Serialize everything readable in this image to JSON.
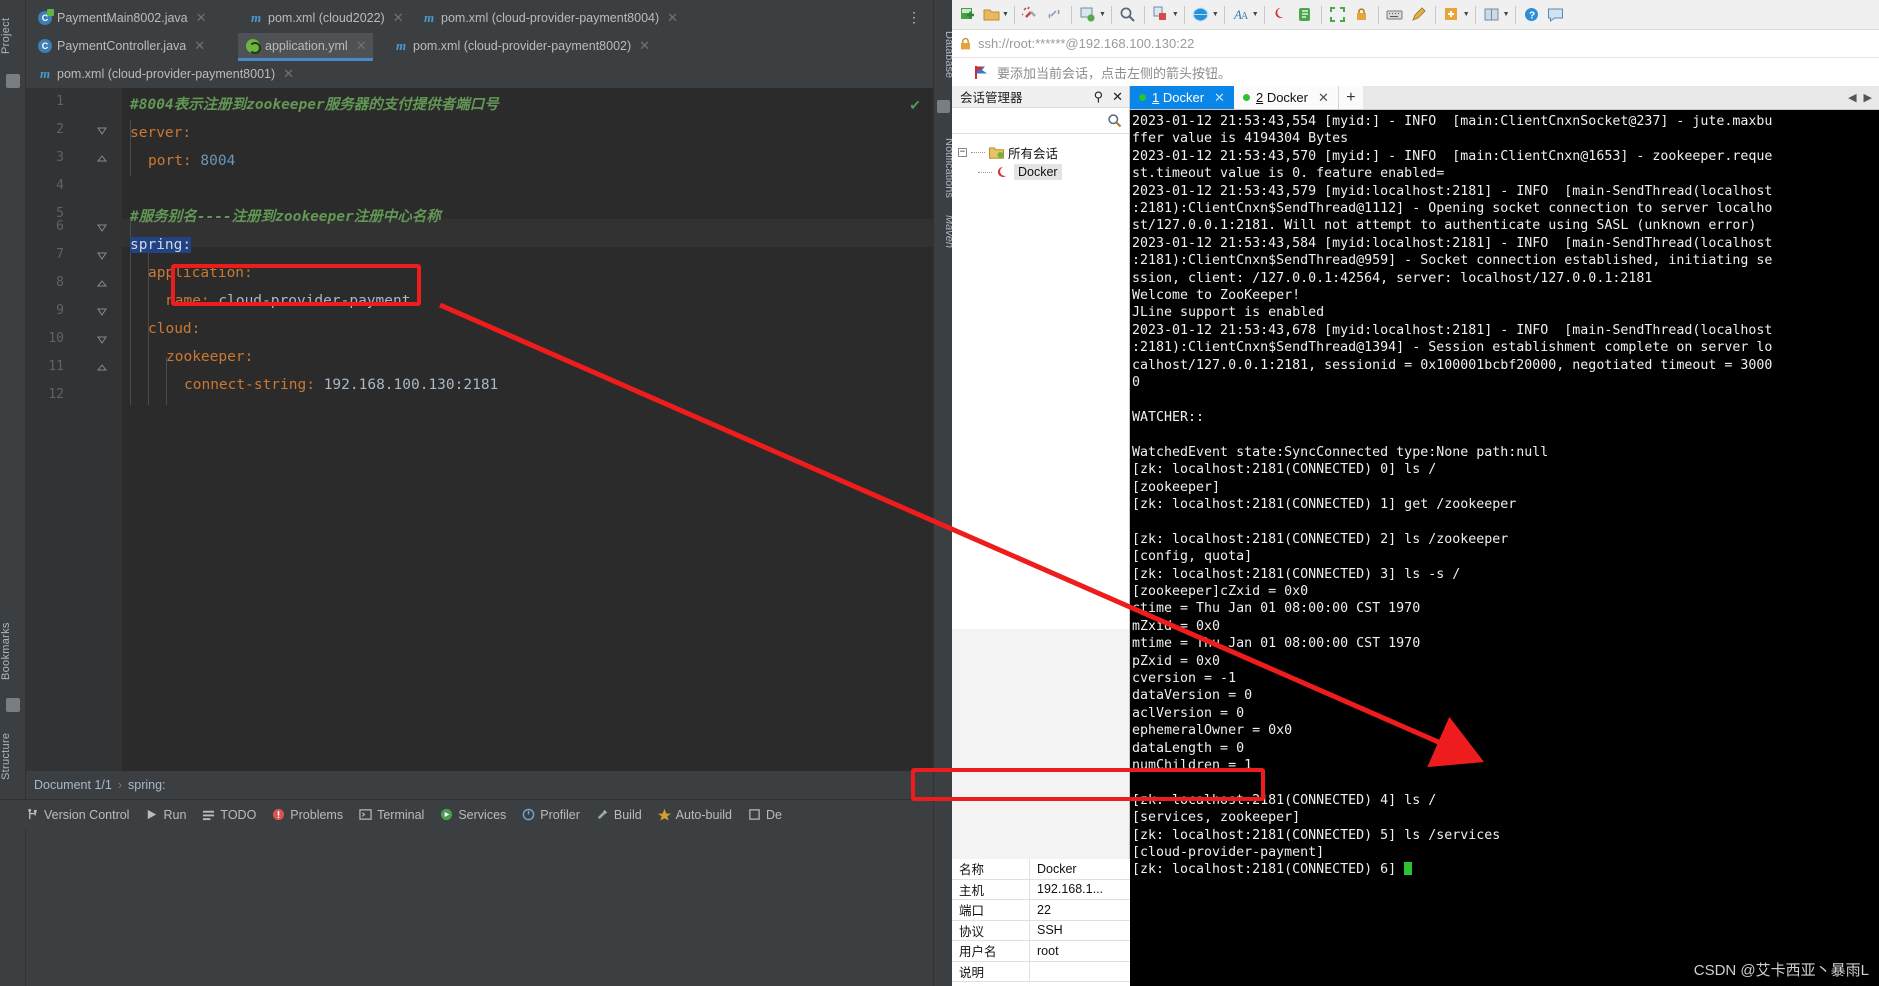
{
  "ide": {
    "rails": {
      "project": "Project",
      "bookmarks": "Bookmarks",
      "structure": "Structure",
      "database": "Database",
      "notifications": "Notifications",
      "maven": "Maven"
    },
    "tabs_row1": [
      {
        "label": "PaymentMain8002.java",
        "icon": "java-main-class-icon",
        "active": false
      },
      {
        "label": "pom.xml (cloud2022)",
        "icon": "maven-icon",
        "active": false
      },
      {
        "label": "pom.xml (cloud-provider-payment8004)",
        "icon": "maven-icon",
        "active": false
      }
    ],
    "tabs_row2": [
      {
        "label": "PaymentController.java",
        "icon": "java-class-icon",
        "active": false
      },
      {
        "label": "application.yml",
        "icon": "spring-yaml-icon",
        "active": true
      },
      {
        "label": "pom.xml (cloud-provider-payment8002)",
        "icon": "maven-icon",
        "active": false
      }
    ],
    "tabs_row3": [
      {
        "label": "pom.xml (cloud-provider-payment8001)",
        "icon": "maven-icon",
        "active": false
      }
    ],
    "code_lines": [
      {
        "n": "1",
        "text": "#8004表示注册到zookeeper服务器的支付提供者端口号"
      },
      {
        "n": "2",
        "text": "server:"
      },
      {
        "n": "3",
        "text": "  port: 8004"
      },
      {
        "n": "4",
        "text": ""
      },
      {
        "n": "5",
        "text": "#服务别名----注册到zookeeper注册中心名称"
      },
      {
        "n": "6",
        "text": "spring:"
      },
      {
        "n": "7",
        "text": "  application:"
      },
      {
        "n": "8",
        "text": "    name: cloud-provider-payment"
      },
      {
        "n": "9",
        "text": "  cloud:"
      },
      {
        "n": "10",
        "text": "    zookeeper:"
      },
      {
        "n": "11",
        "text": "      connect-string: 192.168.100.130:2181"
      },
      {
        "n": "12",
        "text": ""
      }
    ],
    "code_tokens": {
      "l1_comment": "#8004表示注册到zookeeper服务器的支付提供者端口号",
      "l2_key": "server",
      "l3_key": "port",
      "l3_val": "8004",
      "l5_comment": "#服务别名----注册到zookeeper注册中心名称",
      "l6_key": "spring",
      "l7_key": "application",
      "l8_key": "name",
      "l8_val": "cloud-provider-payment",
      "l9_key": "cloud",
      "l10_key": "zookeeper",
      "l11_key": "connect-string",
      "l11_val": "192.168.100.130:2181"
    },
    "breadcrumb": {
      "document": "Document 1/1",
      "separator": "›",
      "path": "spring:"
    },
    "statusbar": [
      {
        "label": "Version Control",
        "icon": "branch-icon"
      },
      {
        "label": "Run",
        "icon": "run-icon"
      },
      {
        "label": "TODO",
        "icon": "todo-icon"
      },
      {
        "label": "Problems",
        "icon": "problems-icon"
      },
      {
        "label": "Terminal",
        "icon": "terminal-icon"
      },
      {
        "label": "Services",
        "icon": "services-icon"
      },
      {
        "label": "Profiler",
        "icon": "profiler-icon"
      },
      {
        "label": "Build",
        "icon": "build-icon"
      },
      {
        "label": "Auto-build",
        "icon": "autobuild-icon"
      },
      {
        "label": "De",
        "icon": "dependencies-icon"
      }
    ]
  },
  "xshell": {
    "address": "ssh://root:******@192.168.100.130:22",
    "notice": "要添加当前会话，点击左侧的箭头按钮。",
    "session_panel": {
      "title": "会话管理器",
      "root": "所有会话",
      "child": "Docker"
    },
    "properties": {
      "rows": [
        {
          "key": "名称",
          "value": "Docker"
        },
        {
          "key": "主机",
          "value": "192.168.1..."
        },
        {
          "key": "端口",
          "value": "22"
        },
        {
          "key": "协议",
          "value": "SSH"
        },
        {
          "key": "用户名",
          "value": "root"
        },
        {
          "key": "说明",
          "value": ""
        }
      ]
    },
    "terminal_tabs": [
      {
        "num": "1",
        "label": "Docker",
        "active": true
      },
      {
        "num": "2",
        "label": "Docker",
        "active": false
      }
    ],
    "new_tab_label": "+",
    "terminal_text": "2023-01-12 21:53:43,554 [myid:] - INFO  [main:ClientCnxnSocket@237] - jute.maxbu\nffer value is 4194304 Bytes\n2023-01-12 21:53:43,570 [myid:] - INFO  [main:ClientCnxn@1653] - zookeeper.reque\nst.timeout value is 0. feature enabled=\n2023-01-12 21:53:43,579 [myid:localhost:2181] - INFO  [main-SendThread(localhost\n:2181):ClientCnxn$SendThread@1112] - Opening socket connection to server localho\nst/127.0.0.1:2181. Will not attempt to authenticate using SASL (unknown error)\n2023-01-12 21:53:43,584 [myid:localhost:2181] - INFO  [main-SendThread(localhost\n:2181):ClientCnxn$SendThread@959] - Socket connection established, initiating se\nssion, client: /127.0.0.1:42564, server: localhost/127.0.0.1:2181\nWelcome to ZooKeeper!\nJLine support is enabled\n2023-01-12 21:53:43,678 [myid:localhost:2181] - INFO  [main-SendThread(localhost\n:2181):ClientCnxn$SendThread@1394] - Session establishment complete on server lo\ncalhost/127.0.0.1:2181, sessionid = 0x100001bcbf20000, negotiated timeout = 3000\n0\n\nWATCHER::\n\nWatchedEvent state:SyncConnected type:None path:null\n[zk: localhost:2181(CONNECTED) 0] ls /\n[zookeeper]\n[zk: localhost:2181(CONNECTED) 1] get /zookeeper\n\n[zk: localhost:2181(CONNECTED) 2] ls /zookeeper\n[config, quota]\n[zk: localhost:2181(CONNECTED) 3] ls -s /\n[zookeeper]cZxid = 0x0\nctime = Thu Jan 01 08:00:00 CST 1970\nmZxid = 0x0\nmtime = Thu Jan 01 08:00:00 CST 1970\npZxid = 0x0\ncversion = -1\ndataVersion = 0\naclVersion = 0\nephemeralOwner = 0x0\ndataLength = 0\nnumChildren = 1\n\n[zk: localhost:2181(CONNECTED) 4] ls /\n[services, zookeeper]\n[zk: localhost:2181(CONNECTED) 5] ls /services\n[cloud-provider-payment]\n[zk: localhost:2181(CONNECTED) 6] ",
    "watermark": "CSDN @艾卡西亚丶暴雨L"
  },
  "annotations": {
    "accent_color": "#ee1c1c",
    "boxes": [
      "code-name-value-box",
      "terminal-services-result-box"
    ],
    "arrow": "red-arrow-from-code-to-terminal"
  }
}
